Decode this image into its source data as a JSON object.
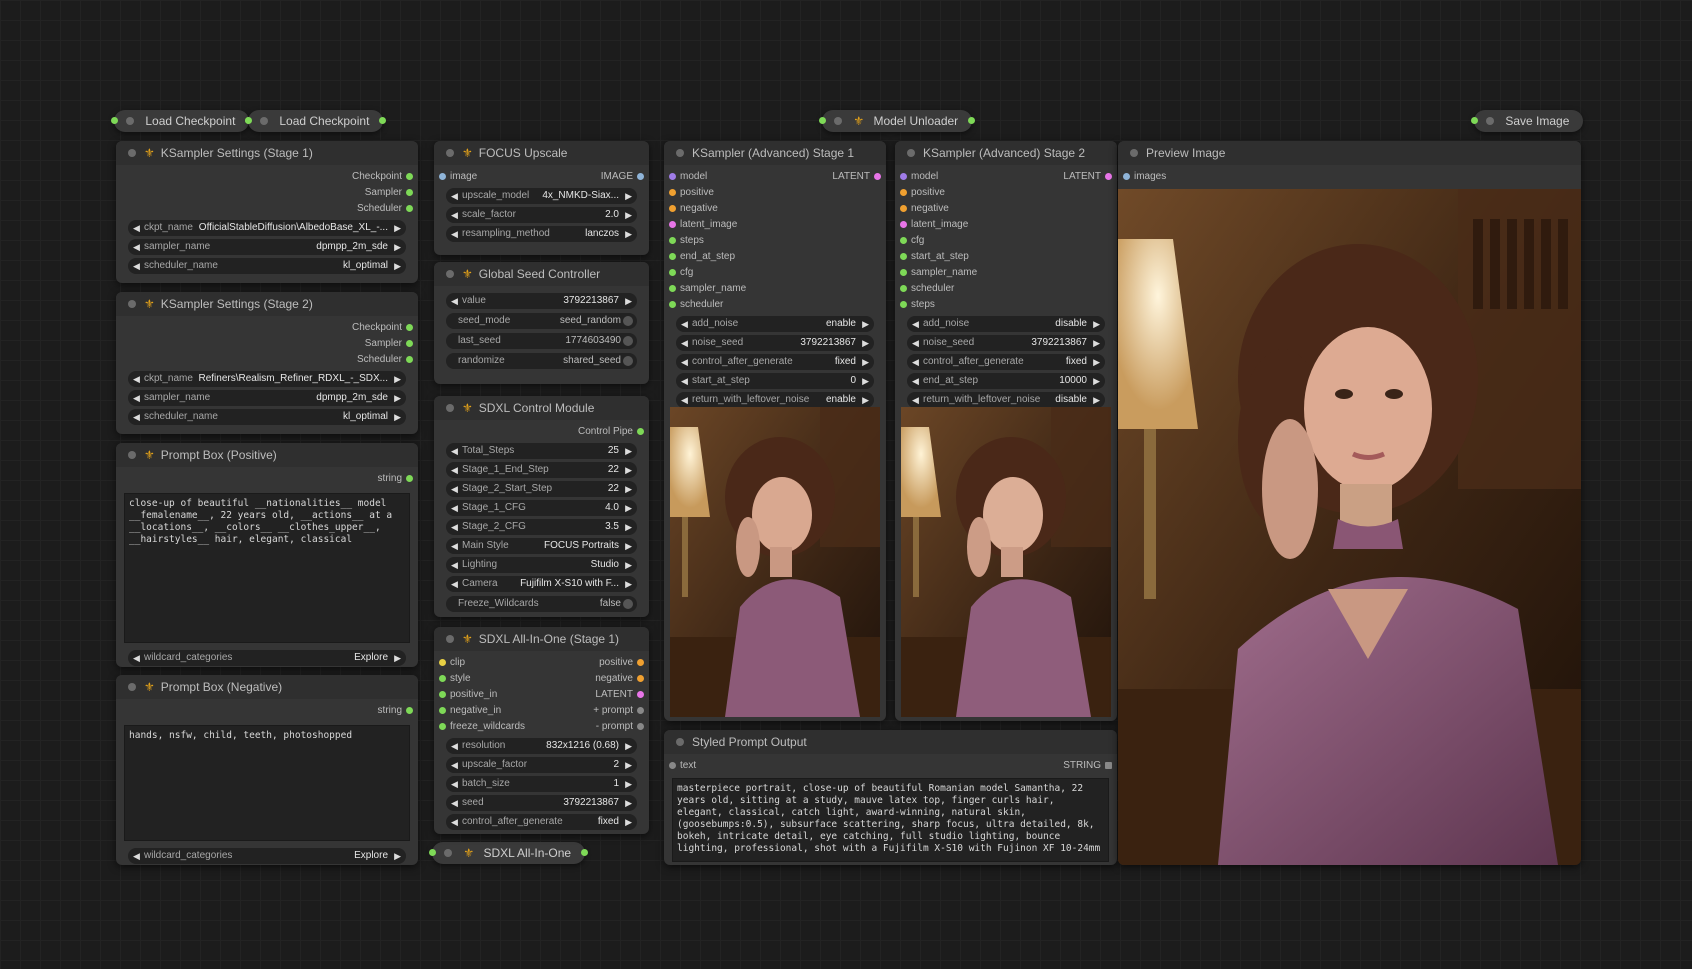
{
  "collapsed_nodes": {
    "load_checkpoint_1": "Load Checkpoint",
    "load_checkpoint_2": "Load Checkpoint",
    "model_unloader": "Model Unloader",
    "save_image": "Save Image",
    "sdxl_all_in_one": "SDXL All-In-One"
  },
  "ks_stage1": {
    "title": "KSampler Settings (Stage 1)",
    "outputs": [
      "Checkpoint",
      "Sampler",
      "Scheduler"
    ],
    "widgets": [
      {
        "name": "ckpt_name",
        "value": "OfficialStableDiffusion\\AlbedoBase_XL_-..."
      },
      {
        "name": "sampler_name",
        "value": "dpmpp_2m_sde"
      },
      {
        "name": "scheduler_name",
        "value": "kl_optimal"
      }
    ]
  },
  "ks_stage2": {
    "title": "KSampler Settings (Stage 2)",
    "outputs": [
      "Checkpoint",
      "Sampler",
      "Scheduler"
    ],
    "widgets": [
      {
        "name": "ckpt_name",
        "value": "Refiners\\Realism_Refiner_RDXL_-_SDX..."
      },
      {
        "name": "sampler_name",
        "value": "dpmpp_2m_sde"
      },
      {
        "name": "scheduler_name",
        "value": "kl_optimal"
      }
    ]
  },
  "prompt_positive": {
    "title": "Prompt Box (Positive)",
    "output": "string",
    "text": "close-up of beautiful __nationalities__ model\n__femalename__, 22 years old, __actions__ at a\n__locations__, __colors__ __clothes_upper__,\n__hairstyles__ hair, elegant, classical",
    "widget": {
      "name": "wildcard_categories",
      "value": "Explore"
    }
  },
  "prompt_negative": {
    "title": "Prompt Box (Negative)",
    "output": "string",
    "text": "hands, nsfw, child, teeth, photoshopped",
    "widget": {
      "name": "wildcard_categories",
      "value": "Explore"
    }
  },
  "focus_upscale": {
    "title": "FOCUS Upscale",
    "input": "image",
    "output": "IMAGE",
    "widgets": [
      {
        "name": "upscale_model",
        "value": "4x_NMKD-Siax..."
      },
      {
        "name": "scale_factor",
        "value": "2.0"
      },
      {
        "name": "resampling_method",
        "value": "lanczos"
      }
    ]
  },
  "seed_controller": {
    "title": "Global Seed Controller",
    "value_widget": {
      "name": "value",
      "value": "3792213867"
    },
    "toggles": [
      {
        "name": "seed_mode",
        "value": "seed_random"
      },
      {
        "name": "last_seed",
        "value": "1774603490"
      },
      {
        "name": "randomize",
        "value": "shared_seed"
      }
    ]
  },
  "control_module": {
    "title": "SDXL Control Module",
    "output": "Control Pipe",
    "widgets": [
      {
        "name": "Total_Steps",
        "value": "25"
      },
      {
        "name": "Stage_1_End_Step",
        "value": "22"
      },
      {
        "name": "Stage_2_Start_Step",
        "value": "22"
      },
      {
        "name": "Stage_1_CFG",
        "value": "4.0"
      },
      {
        "name": "Stage_2_CFG",
        "value": "3.5"
      },
      {
        "name": "Main Style",
        "value": "FOCUS Portraits"
      },
      {
        "name": "Lighting",
        "value": "Studio"
      },
      {
        "name": "Camera",
        "value": "Fujifilm X-S10 with F..."
      }
    ],
    "toggle": {
      "name": "Freeze_Wildcards",
      "value": "false"
    }
  },
  "all_in_one": {
    "title": "SDXL All-In-One (Stage 1)",
    "io": [
      {
        "in": "clip",
        "out": "positive"
      },
      {
        "in": "style",
        "out": "negative"
      },
      {
        "in": "positive_in",
        "out": "LATENT"
      },
      {
        "in": "negative_in",
        "out": "+ prompt"
      },
      {
        "in": "freeze_wildcards",
        "out": "- prompt"
      }
    ],
    "widgets": [
      {
        "name": "resolution",
        "value": "832x1216 (0.68)"
      },
      {
        "name": "upscale_factor",
        "value": "2"
      },
      {
        "name": "batch_size",
        "value": "1"
      },
      {
        "name": "seed",
        "value": "3792213867"
      },
      {
        "name": "control_after_generate",
        "value": "fixed"
      }
    ]
  },
  "ksa_stage1": {
    "title": "KSampler (Advanced) Stage 1",
    "output": "LATENT",
    "inputs": [
      "model",
      "positive",
      "negative",
      "latent_image",
      "steps",
      "end_at_step",
      "cfg",
      "sampler_name",
      "scheduler"
    ],
    "widgets": [
      {
        "name": "add_noise",
        "value": "enable"
      },
      {
        "name": "noise_seed",
        "value": "3792213867"
      },
      {
        "name": "control_after_generate",
        "value": "fixed"
      },
      {
        "name": "start_at_step",
        "value": "0"
      },
      {
        "name": "return_with_leftover_noise",
        "value": "enable"
      }
    ]
  },
  "ksa_stage2": {
    "title": "KSampler (Advanced) Stage 2",
    "output": "LATENT",
    "inputs": [
      "model",
      "positive",
      "negative",
      "latent_image",
      "cfg",
      "start_at_step",
      "sampler_name",
      "scheduler",
      "steps"
    ],
    "widgets": [
      {
        "name": "add_noise",
        "value": "disable"
      },
      {
        "name": "noise_seed",
        "value": "3792213867"
      },
      {
        "name": "control_after_generate",
        "value": "fixed"
      },
      {
        "name": "end_at_step",
        "value": "10000"
      },
      {
        "name": "return_with_leftover_noise",
        "value": "disable"
      }
    ]
  },
  "styled_prompt": {
    "title": "Styled Prompt Output",
    "input": "text",
    "output": "STRING",
    "text": "masterpiece portrait, close-up of beautiful Romanian model Samantha, 22\nyears old, sitting at a study, mauve latex top, finger curls hair,\nelegant, classical, catch light, award-winning, natural skin,\n(goosebumps:0.5), subsurface scattering, sharp focus, ultra detailed, 8k,\nbokeh, intricate detail, eye catching, full studio lighting, bounce\nlighting, professional, shot with a Fujifilm X-S10 with Fujinon XF 10-24mm"
  },
  "preview": {
    "title": "Preview Image",
    "input": "images"
  },
  "colors": {
    "background": "#1c1c1c",
    "node_body": "#353535",
    "node_title": "#2f2f2f",
    "widget": "#222222",
    "accent_fleur": "#e3a21a"
  }
}
